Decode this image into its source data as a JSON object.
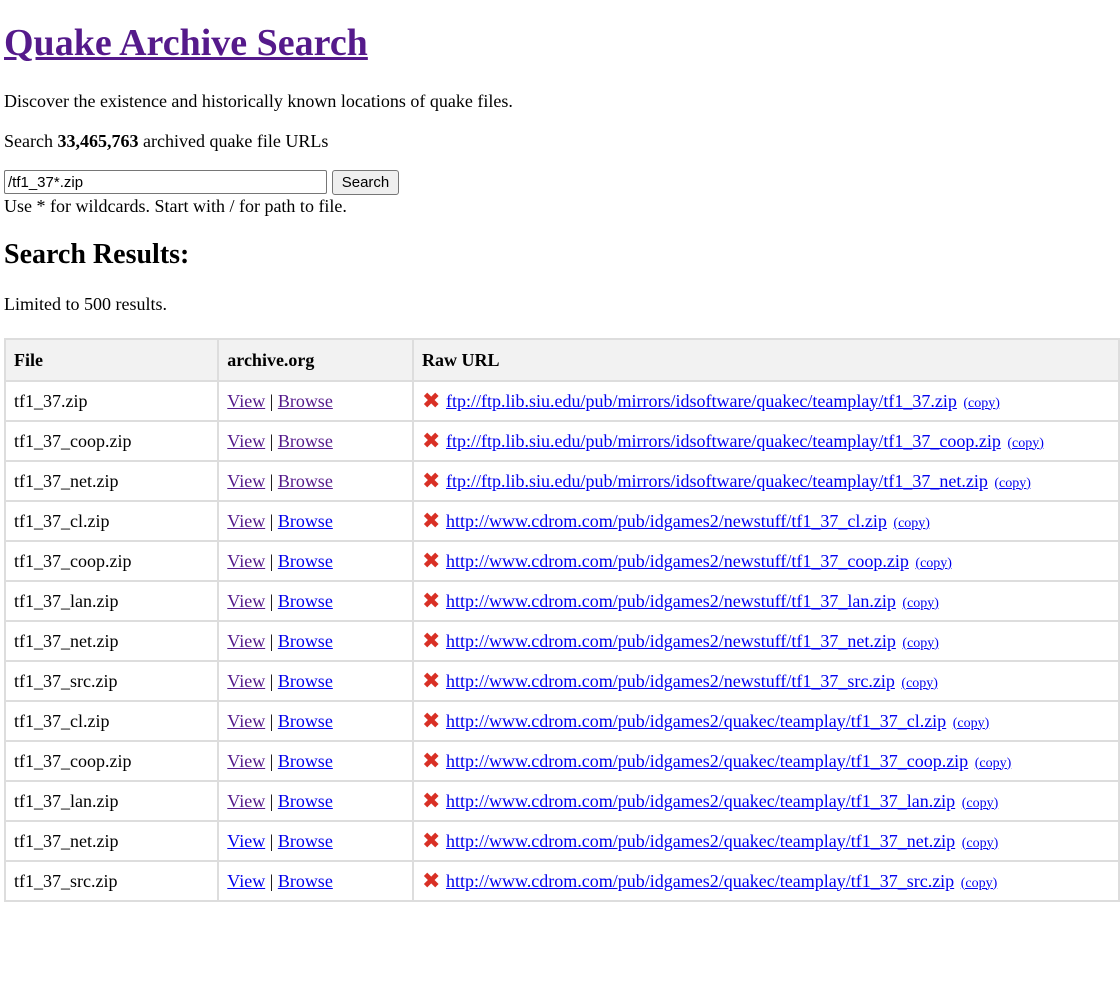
{
  "page": {
    "title": "Quake Archive Search",
    "intro": "Discover the existence and historically known locations of quake files.",
    "count_prefix": "Search ",
    "count_value": "33,465,763",
    "count_suffix": " archived quake file URLs",
    "help": "Use * for wildcards. Start with / for path to file.",
    "results_heading": "Search Results:",
    "limit_note": "Limited to 500 results."
  },
  "search": {
    "value": "/tf1_37*.zip",
    "button": "Search"
  },
  "table": {
    "headers": [
      "File",
      "archive.org",
      "Raw URL"
    ],
    "view_label": "View",
    "browse_label": "Browse",
    "separator": "|",
    "copy_label": "(copy)",
    "status_icon": "red-x-icon",
    "rows": [
      {
        "file": "tf1_37.zip",
        "url": "ftp://ftp.lib.siu.edu/pub/mirrors/idsoftware/quakec/teamplay/tf1_37.zip",
        "view_visited": true,
        "browse_visited": true
      },
      {
        "file": "tf1_37_coop.zip",
        "url": "ftp://ftp.lib.siu.edu/pub/mirrors/idsoftware/quakec/teamplay/tf1_37_coop.zip",
        "view_visited": true,
        "browse_visited": true
      },
      {
        "file": "tf1_37_net.zip",
        "url": "ftp://ftp.lib.siu.edu/pub/mirrors/idsoftware/quakec/teamplay/tf1_37_net.zip",
        "view_visited": true,
        "browse_visited": true
      },
      {
        "file": "tf1_37_cl.zip",
        "url": "http://www.cdrom.com/pub/idgames2/newstuff/tf1_37_cl.zip",
        "view_visited": true,
        "browse_visited": false
      },
      {
        "file": "tf1_37_coop.zip",
        "url": "http://www.cdrom.com/pub/idgames2/newstuff/tf1_37_coop.zip",
        "view_visited": true,
        "browse_visited": false
      },
      {
        "file": "tf1_37_lan.zip",
        "url": "http://www.cdrom.com/pub/idgames2/newstuff/tf1_37_lan.zip",
        "view_visited": true,
        "browse_visited": false
      },
      {
        "file": "tf1_37_net.zip",
        "url": "http://www.cdrom.com/pub/idgames2/newstuff/tf1_37_net.zip",
        "view_visited": true,
        "browse_visited": false
      },
      {
        "file": "tf1_37_src.zip",
        "url": "http://www.cdrom.com/pub/idgames2/newstuff/tf1_37_src.zip",
        "view_visited": true,
        "browse_visited": false
      },
      {
        "file": "tf1_37_cl.zip",
        "url": "http://www.cdrom.com/pub/idgames2/quakec/teamplay/tf1_37_cl.zip",
        "view_visited": true,
        "browse_visited": false
      },
      {
        "file": "tf1_37_coop.zip",
        "url": "http://www.cdrom.com/pub/idgames2/quakec/teamplay/tf1_37_coop.zip",
        "view_visited": true,
        "browse_visited": false
      },
      {
        "file": "tf1_37_lan.zip",
        "url": "http://www.cdrom.com/pub/idgames2/quakec/teamplay/tf1_37_lan.zip",
        "view_visited": true,
        "browse_visited": false
      },
      {
        "file": "tf1_37_net.zip",
        "url": "http://www.cdrom.com/pub/idgames2/quakec/teamplay/tf1_37_net.zip",
        "view_visited": false,
        "browse_visited": false
      },
      {
        "file": "tf1_37_src.zip",
        "url": "http://www.cdrom.com/pub/idgames2/quakec/teamplay/tf1_37_src.zip",
        "view_visited": false,
        "browse_visited": false
      }
    ]
  },
  "colors": {
    "link": "#0000ee",
    "visited_link": "#551a8b",
    "error_icon": "#d93025",
    "header_bg": "#f2f2f2",
    "border": "#dddddd"
  }
}
